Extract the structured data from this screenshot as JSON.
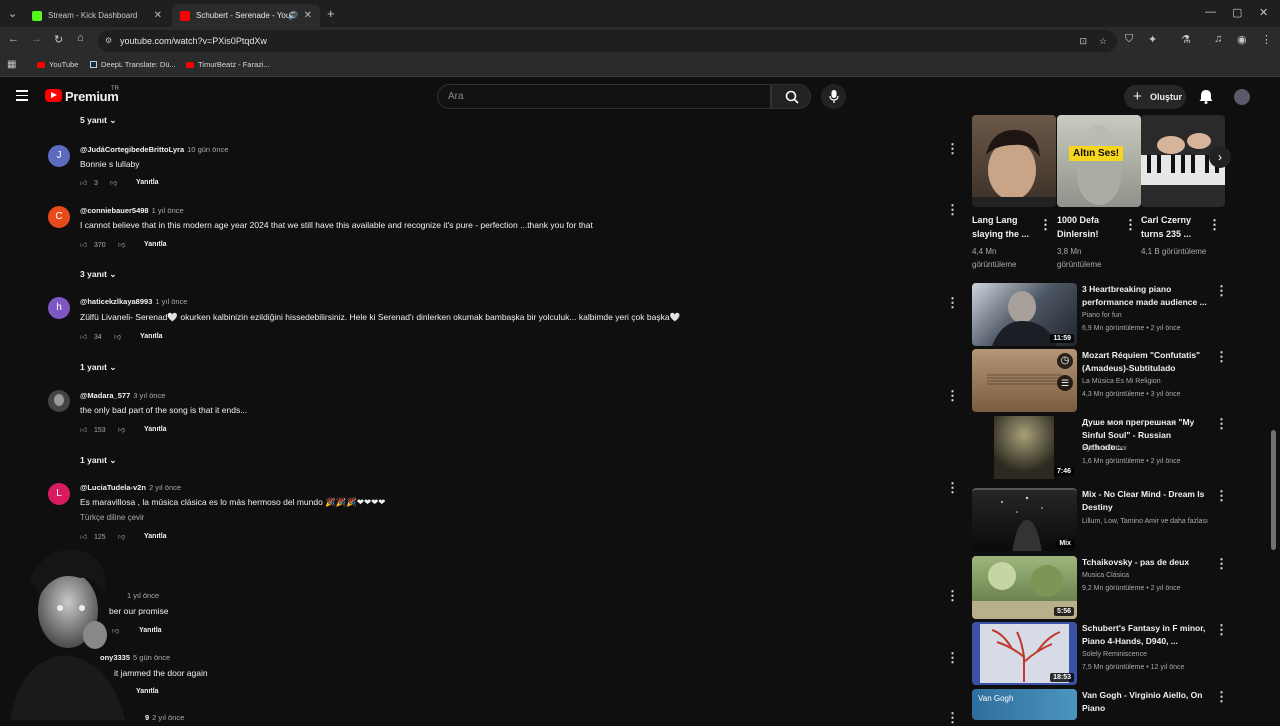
{
  "browser": {
    "tabs": [
      {
        "title": "Stream - Kick Dashboard",
        "favicon_color": "#53fc18"
      },
      {
        "title": "Schubert - Serenade - YouT",
        "favicon_color": "#ff0000"
      }
    ],
    "url": "youtube.com/watch?v=PXis0PtqdXw",
    "bookmarks": [
      "YouTube",
      "DeepL Translate: Dü...",
      "TimurBeatz - Farazi..."
    ]
  },
  "header": {
    "logo_text": "Premium",
    "logo_sup": "TR",
    "search_placeholder": "Ara",
    "create_label": "Oluştur"
  },
  "comments": [
    {
      "kind": "toggle",
      "label": "5 yanıt"
    },
    {
      "user": "@JudáCortegibedeBrittoLyra",
      "time": "10 gün önce",
      "text": "Bonnie s lullaby",
      "likes": "3",
      "avatar_letter": "J",
      "avatar_color": "#5c6bc0",
      "reply": "Yanıtla"
    },
    {
      "user": "@conniebauer5498",
      "time": "1 yıl önce",
      "text": "I cannot believe that in this modern age year 2024 that we still have this available and recognize it's  pure - perfection ...thank you for that",
      "likes": "370",
      "avatar_letter": "C",
      "avatar_color": "#e64a19",
      "reply": "Yanıtla"
    },
    {
      "kind": "toggle",
      "label": "3 yanıt"
    },
    {
      "user": "@haticekzlkaya8993",
      "time": "1 yıl önce",
      "text": "Zülfü Livaneli- Serenad🤍 okurken kalbinizin ezildiğini hissedebilirsiniz. Hele ki Serenad'ı dinlerken okumak bambaşka bir yolculuk... kalbimde yeri çok başka🤍",
      "likes": "34",
      "avatar_letter": "h",
      "avatar_color": "#7e57c2",
      "reply": "Yanıtla"
    },
    {
      "kind": "toggle",
      "label": "1 yanıt"
    },
    {
      "user": "@Madara_577",
      "time": "3 yıl önce",
      "text": "the only bad part of the song is that it ends...",
      "likes": "153",
      "avatar_letter": "",
      "avatar_color": "#444444",
      "reply": "Yanıtla"
    },
    {
      "kind": "toggle",
      "label": "1 yanıt"
    },
    {
      "user": "@LuciaTudela-v2n",
      "time": "2 yıl önce",
      "text": "Es maravillosa , la música clásica es lo más hermoso del mundo 🎉🎉🎉❤❤❤❤",
      "translate": "Türkçe diline çevir",
      "likes": "125",
      "avatar_letter": "L",
      "avatar_color": "#d81b60",
      "reply": "Yanıtla"
    },
    {
      "user": "",
      "time": "1 yıl önce",
      "text": "ber our promise",
      "likes": "",
      "reply": "Yanıtla"
    },
    {
      "user": "ony3335",
      "time": "5 gün önce",
      "text": "it jammed the door again",
      "likes": "",
      "reply": "Yanıtla"
    },
    {
      "user": "9",
      "time": "2 yıl önce",
      "text": "",
      "likes": ""
    }
  ],
  "shelf": [
    {
      "title": "Lang Lang slaying the ...",
      "views": "4,4 Mn görüntüleme",
      "thumb_color": "#5a4a3c"
    },
    {
      "title": "1000 Defa Dinlersin!",
      "views": "3,8 Mn görüntüleme",
      "thumb_color": "#b9bcb0",
      "badge": "Altın Ses!"
    },
    {
      "title": "Carl Czerny turns 235 ...",
      "views": "4,1 B görüntüleme",
      "thumb_color": "#2c2c2c"
    }
  ],
  "videos": [
    {
      "title": "3 Heartbreaking piano performance made audience ...",
      "channel": "Piano for fun",
      "meta": "6,9 Mn görüntüleme • 2 yıl önce",
      "duration": "11:59",
      "thumb_color": "#3a4452"
    },
    {
      "title": "Mozart Réquiem \"Confutatis\" (Amadeus)-Subtitulado",
      "channel": "La Música Es Mi Religion",
      "meta": "4,3 Mn görüntüleme • 3 yıl önce",
      "duration": "",
      "thumb_color": "#8a6a48"
    },
    {
      "title": "Душе моя прегрешная \"My Sinful Soul\" - Russian Orthodo...",
      "channel": "Hymnoi Orthoi",
      "meta": "1,6 Mn görüntüleme • 2 yıl önce",
      "duration": "7:46",
      "thumb_color": "#2d2a22"
    },
    {
      "title": "Mix - No Clear Mind - Dream Is Destiny",
      "channel": "Lillum, Low, Tamino Amir ve daha fazlası",
      "meta": "",
      "duration": "Mix",
      "thumb_color": "#1e1e1e"
    },
    {
      "title": "Tchaikovsky - pas de deux",
      "channel": "Musica Clásica",
      "meta": "9,2 Mn görüntüleme • 2 yıl önce",
      "duration": "5:56",
      "thumb_color": "#6f8450"
    },
    {
      "title": "Schubert's Fantasy in F minor, Piano 4-Hands, D940, ...",
      "channel": "Solely Reminiscence",
      "meta": "7,5 Mn görüntüleme • 12 yıl önce",
      "duration": "18:53",
      "thumb_color": "#3b52a8"
    },
    {
      "title": "Van Gogh - Virginio Aiello, On Piano",
      "channel": "",
      "meta": "",
      "duration": "",
      "thumb_color": "#3d7ca8",
      "thumb_text": "Van Gogh"
    }
  ]
}
